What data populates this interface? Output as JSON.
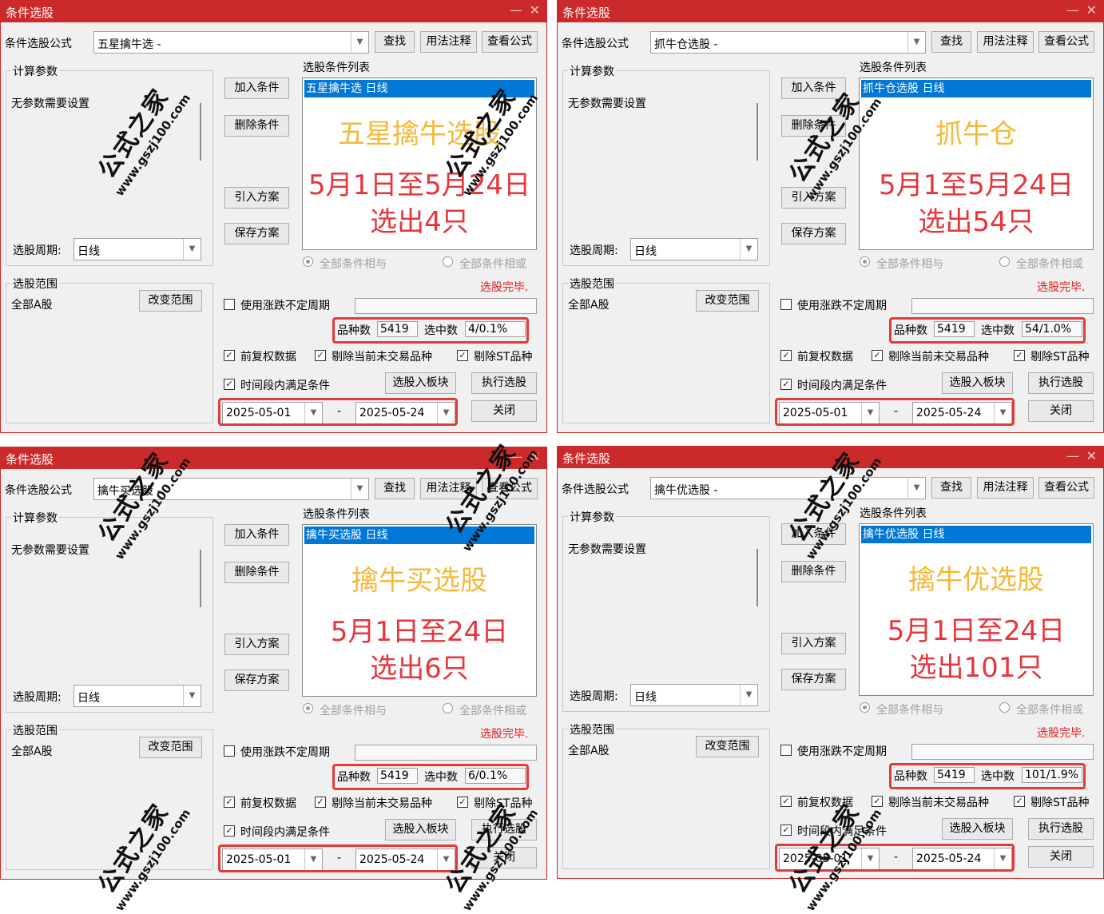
{
  "common": {
    "window_title": "条件选股",
    "formula_label": "条件选股公式",
    "btn_find": "查找",
    "btn_usage": "用法注释",
    "btn_view": "查看公式",
    "params_label": "计算参数",
    "no_params": "无参数需要设置",
    "list_label": "选股条件列表",
    "btn_add": "加入条件",
    "btn_delete": "删除条件",
    "btn_import": "引入方案",
    "btn_save": "保存方案",
    "period_label": "选股周期:",
    "period_value": "日线",
    "radio_and": "全部条件相与",
    "radio_or": "全部条件相或",
    "range_label": "选股范围",
    "range_value": "全部A股",
    "btn_change_range": "改变范围",
    "done_text": "选股完毕.",
    "use_volatile": "使用涨跌不定周期",
    "count_label": "品种数",
    "count_value": "5419",
    "selected_label": "选中数",
    "cb_fq": "前复权数据",
    "cb_exclude_notrade": "剔除当前未交易品种",
    "cb_exclude_st": "剔除ST品种",
    "cb_period": "时间段内满足条件",
    "btn_to_block": "选股入板块",
    "btn_execute": "执行选股",
    "btn_close": "关闭",
    "date_from": "2025-05-01",
    "date_sep": "-",
    "date_to": "2025-05-24",
    "minimize_glyph": "—",
    "close_glyph": "✕",
    "dropdown_glyph": "▼",
    "check_glyph": "✓"
  },
  "watermark": {
    "text": "公式之家",
    "url": "www.gszj100.com"
  },
  "windows": [
    {
      "formula": "五星擒牛选  -",
      "list_item": "五星擒牛选  日线",
      "headline": "五星擒牛选股",
      "line1": "5月1日至5月24日",
      "line2": "选出4只",
      "selected": "4/0.1%"
    },
    {
      "formula": "抓牛仓选股  -",
      "list_item": "抓牛仓选股  日线",
      "headline": "抓牛仓",
      "line1": "5月1至5月24日",
      "line2": "选出54只",
      "selected": "54/1.0%"
    },
    {
      "formula": "擒牛买选股  -",
      "list_item": "擒牛买选股  日线",
      "headline": "擒牛买选股",
      "line1": "5月1日至24日",
      "line2": "选出6只",
      "selected": "6/0.1%"
    },
    {
      "formula": "擒牛优选股  -",
      "list_item": "擒牛优选股  日线",
      "headline": "擒牛优选股",
      "line1": "5月1日至24日",
      "line2": "选出101只",
      "selected": "101/1.9%"
    }
  ]
}
